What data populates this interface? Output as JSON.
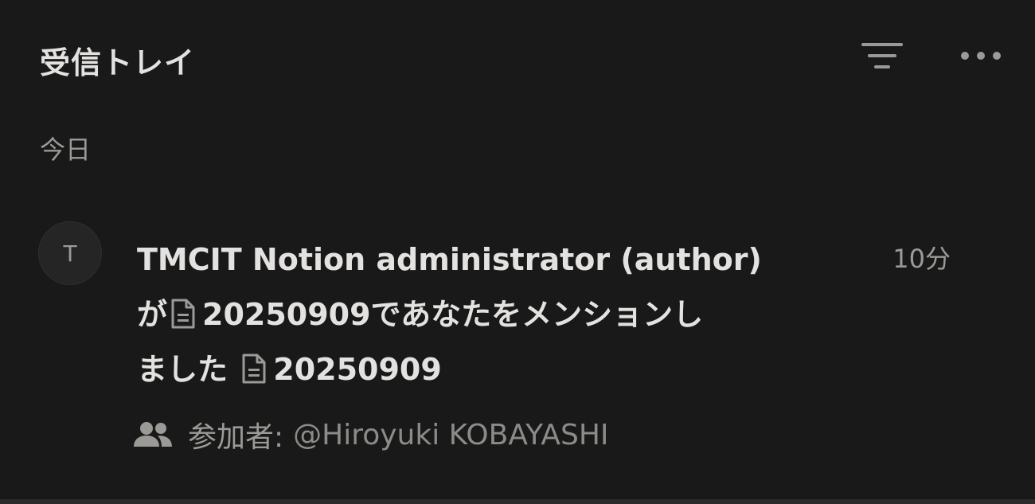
{
  "header": {
    "title": "受信トレイ",
    "filter_icon": "filter-lines-icon",
    "more_icon": "more-horizontal-icon"
  },
  "section": {
    "label": "今日"
  },
  "notification": {
    "avatar_initial": "T",
    "actor": "TMCIT Notion administrator (author)",
    "text_part1": "が",
    "page_name": "20250909",
    "text_part2": "であなたをメンションし",
    "text_part3": "ました",
    "page_link": "20250909",
    "time": "10分",
    "participants_label": "参加者:",
    "participant": "@Hiroyuki KOBAYASHI",
    "participants_icon": "people-icon"
  },
  "colors": {
    "background": "#191919",
    "text_primary": "#e3e2e0",
    "text_secondary": "#9b9a97"
  }
}
